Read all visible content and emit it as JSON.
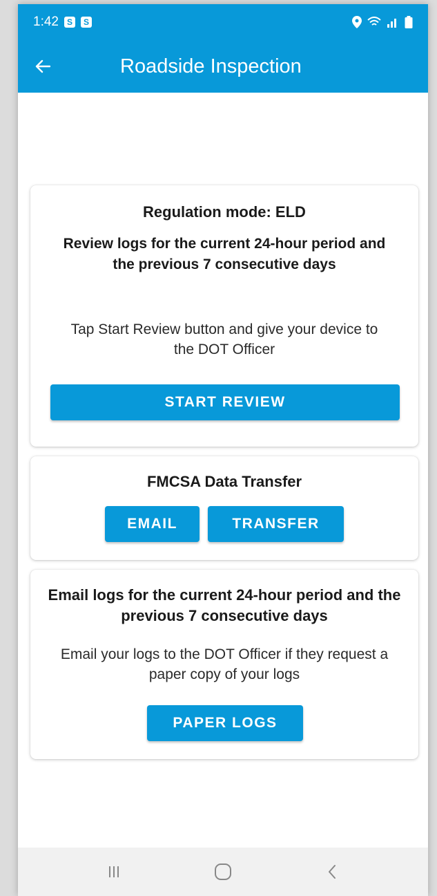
{
  "status_bar": {
    "time": "1:42",
    "badge_1": "S",
    "badge_2": "S"
  },
  "app_bar": {
    "title": "Roadside Inspection"
  },
  "review_card": {
    "title": "Regulation mode: ELD",
    "subtitle": "Review logs for the current 24-hour period and the previous 7 consecutive days",
    "instruction": "Tap Start Review button and give your device to the DOT Officer",
    "start_review_label": "START REVIEW"
  },
  "transfer_card": {
    "title": "FMCSA Data Transfer",
    "email_label": "EMAIL",
    "transfer_label": "TRANSFER"
  },
  "paper_card": {
    "title": "Email logs for the current 24-hour period and the previous 7 consecutive days",
    "instruction": "Email your logs to the DOT Officer if they request a paper copy of your logs",
    "paper_logs_label": "PAPER LOGS"
  },
  "colors": {
    "primary": "#0899d9",
    "surface": "#ffffff",
    "nav_background": "#f1f1f1"
  },
  "icons": {
    "back": "arrow-left-icon",
    "location": "location-pin-icon",
    "wifi": "wifi-icon",
    "signal": "signal-icon",
    "battery": "battery-icon",
    "recents": "recent-apps-icon",
    "home": "home-icon",
    "nav_back": "nav-back-icon"
  }
}
